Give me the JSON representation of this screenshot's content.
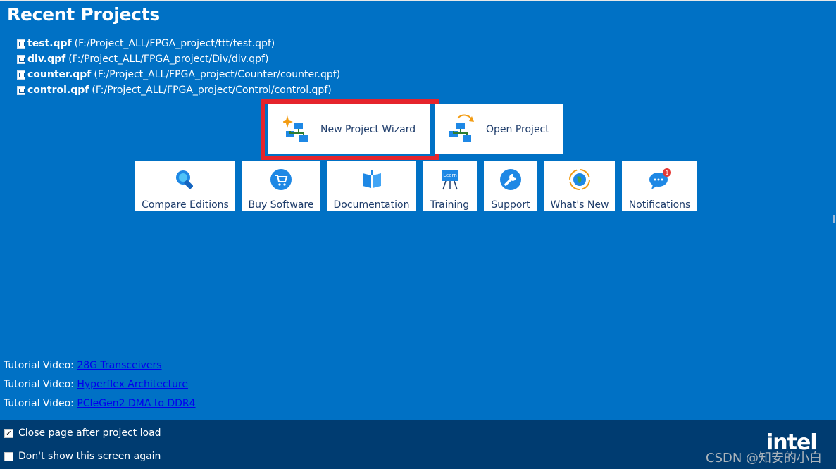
{
  "title": "Recent Projects",
  "recent_projects": [
    {
      "name": "test.qpf",
      "path": "(F:/Project_ALL/FPGA_project/ttt/test.qpf)"
    },
    {
      "name": "div.qpf",
      "path": "(F:/Project_ALL/FPGA_project/Div/div.qpf)"
    },
    {
      "name": "counter.qpf",
      "path": "(F:/Project_ALL/FPGA_project/Counter/counter.qpf)"
    },
    {
      "name": "control.qpf",
      "path": "(F:/Project_ALL/FPGA_project/Control/control.qpf)"
    }
  ],
  "actions": {
    "new_project": "New Project Wizard",
    "open_project": "Open Project"
  },
  "tiles": {
    "compare": "Compare Editions",
    "buy": "Buy Software",
    "documentation": "Documentation",
    "training": "Training",
    "support": "Support",
    "whats_new": "What's New",
    "notifications": "Notifications",
    "notifications_count": "1",
    "training_sign": "Learn"
  },
  "tutorials": [
    {
      "label": "Tutorial Video:",
      "link": "28G Transceivers"
    },
    {
      "label": "Tutorial Video:",
      "link": "Hyperflex Architecture"
    },
    {
      "label": "Tutorial Video:",
      "link": "PCIeGen2 DMA to DDR4"
    }
  ],
  "options": {
    "close_after_load": "Close page after project load",
    "close_after_load_checked": true,
    "dont_show_again": "Don't show this screen again",
    "dont_show_again_checked": false
  },
  "brand": "intel",
  "watermark": "CSDN @知安的小白",
  "colors": {
    "background": "#0071c5",
    "bottom_bar": "#003c71",
    "highlight": "#e5242c",
    "tile_text": "#1f3d6b",
    "link": "#0000ee"
  }
}
